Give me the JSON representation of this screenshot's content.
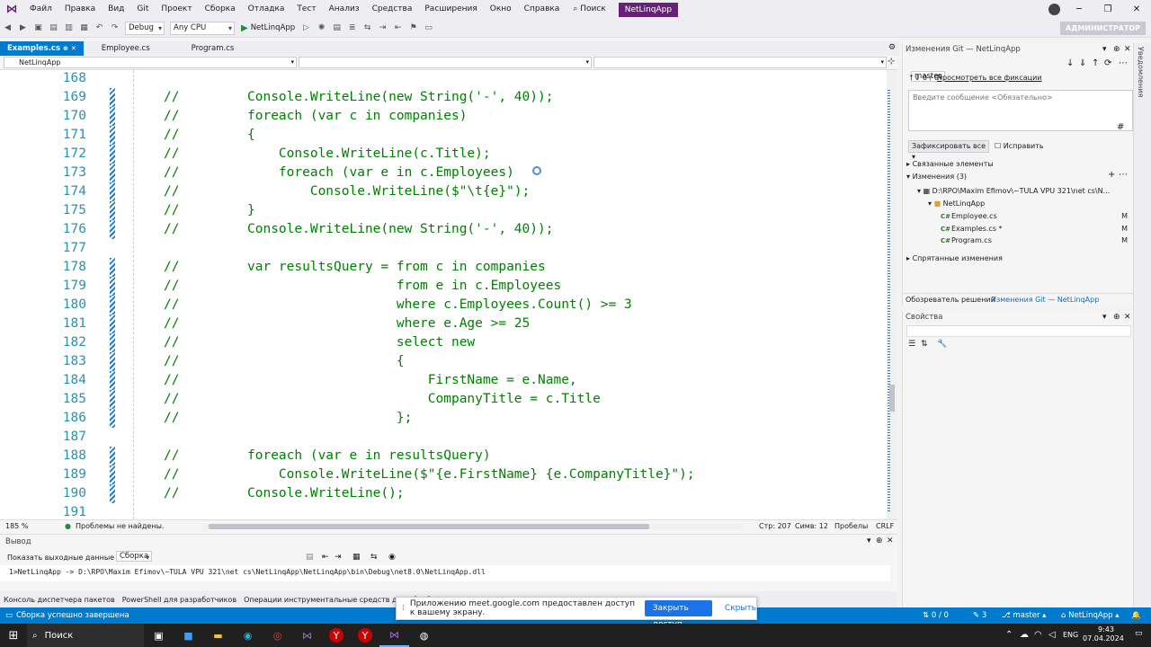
{
  "menu": {
    "items": [
      "Файл",
      "Правка",
      "Вид",
      "Git",
      "Проект",
      "Сборка",
      "Отладка",
      "Тест",
      "Анализ",
      "Средства",
      "Расширения",
      "Окно",
      "Справка"
    ],
    "search": "Поиск",
    "solution": "NetLinqApp"
  },
  "toolbar": {
    "config": "Debug",
    "platform": "Any CPU",
    "run_target": "NetLinqApp",
    "admin": "АДМИНИСТРАТОР"
  },
  "tabs": [
    {
      "label": "Examples.cs",
      "active": true
    },
    {
      "label": "Employee.cs",
      "active": false
    },
    {
      "label": "Program.cs",
      "active": false
    }
  ],
  "navbar": {
    "project": "NetLinqApp"
  },
  "code": [
    {
      "ln": "168",
      "text": "",
      "changed": false
    },
    {
      "ln": "169",
      "text": "Console.WriteLine(new String('-', 40));",
      "changed": true
    },
    {
      "ln": "170",
      "text": "foreach (var c in companies)",
      "changed": true
    },
    {
      "ln": "171",
      "text": "{",
      "changed": true
    },
    {
      "ln": "172",
      "text": "    Console.WriteLine(c.Title);",
      "changed": true
    },
    {
      "ln": "173",
      "text": "    foreach (var e in c.Employees)",
      "changed": true
    },
    {
      "ln": "174",
      "text": "        Console.WriteLine($\"\\t{e}\");",
      "changed": true
    },
    {
      "ln": "175",
      "text": "}",
      "changed": true
    },
    {
      "ln": "176",
      "text": "Console.WriteLine(new String('-', 40));",
      "changed": true
    },
    {
      "ln": "177",
      "text": "",
      "changed": false
    },
    {
      "ln": "178",
      "text": "var resultsQuery = from c in companies",
      "changed": true
    },
    {
      "ln": "179",
      "text": "                   from e in c.Employees",
      "changed": true
    },
    {
      "ln": "180",
      "text": "                   where c.Employees.Count() >= 3",
      "changed": true
    },
    {
      "ln": "181",
      "text": "                   where e.Age >= 25",
      "changed": true
    },
    {
      "ln": "182",
      "text": "                   select new",
      "changed": true
    },
    {
      "ln": "183",
      "text": "                   {",
      "changed": true
    },
    {
      "ln": "184",
      "text": "                       FirstName = e.Name,",
      "changed": true
    },
    {
      "ln": "185",
      "text": "                       CompanyTitle = c.Title",
      "changed": true
    },
    {
      "ln": "186",
      "text": "                   };",
      "changed": true
    },
    {
      "ln": "187",
      "text": "",
      "changed": false
    },
    {
      "ln": "188",
      "text": "foreach (var e in resultsQuery)",
      "changed": true
    },
    {
      "ln": "189",
      "text": "    Console.WriteLine($\"{e.FirstName} {e.CompanyTitle}\");",
      "changed": true
    },
    {
      "ln": "190",
      "text": "Console.WriteLine();",
      "changed": true
    },
    {
      "ln": "191",
      "text": "",
      "changed": false
    }
  ],
  "comment_marker": "//",
  "editor_status": {
    "zoom": "185 %",
    "issues": "Проблемы не найдены.",
    "line": "Стр: 207",
    "col": "Симв: 12",
    "spaces": "Пробелы",
    "eol": "CRLF"
  },
  "output": {
    "title": "Вывод",
    "show_label": "Показать выходные данные из:",
    "source": "Сборка",
    "text": "1>NetLinqApp -> D:\\RPO\\Maxim Efimov\\~TULA VPU 321\\net cs\\NetLinqApp\\NetLinqApp\\bin\\Debug\\net8.0\\NetLinqApp.dll"
  },
  "bottom_tabs": [
    "Консоль диспетчера пакетов",
    "PowerShell для разработчиков",
    "Операции инструментальные средств для обработки"
  ],
  "status": {
    "message": "Сборка успешно завершена",
    "git_counts": "0 / 0",
    "pencil": "3",
    "branch": "master",
    "repo": "NetLinqApp"
  },
  "share": {
    "text": "Приложению meet.google.com предоставлен доступ к вашему экрану.",
    "stop": "Закрыть доступ",
    "hide": "Скрыть"
  },
  "taskbar": {
    "search": "Поиск",
    "lang": "ENG",
    "time": "9:43",
    "date": "07.04.2024"
  },
  "git": {
    "title": "Изменения Git — NetLinqApp",
    "branch": "master",
    "counts": "0 / 0",
    "view_all": "Просмотреть все фиксации",
    "msg_placeholder": "Введите сообщение <Обязательно>",
    "commit_all": "Зафиксировать все",
    "amend": "Исправить",
    "linked": "Связанные элементы",
    "changes": "Изменения (3)",
    "path": "D:\\RPO\\Maxim Efimov\\~TULA VPU 321\\net cs\\N...",
    "folder": "NetLinqApp",
    "files": [
      {
        "name": "Employee.cs",
        "status": "M"
      },
      {
        "name": "Examples.cs *",
        "status": "M"
      },
      {
        "name": "Program.cs",
        "status": "M"
      }
    ],
    "stashes": "Спрятанные изменения",
    "tab1": "Обозреватель решений",
    "tab2": "Изменения Git — NetLinqApp"
  },
  "props": {
    "title": "Свойства"
  },
  "side_strip": "Уведомления"
}
